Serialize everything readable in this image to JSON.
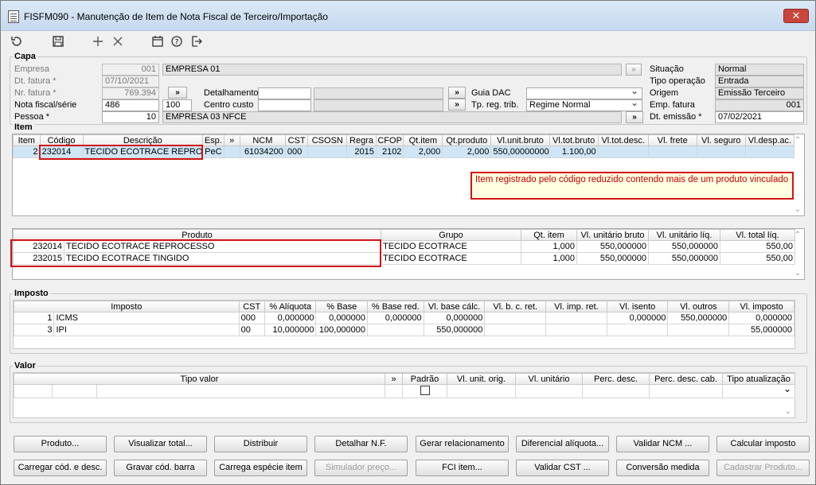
{
  "window": {
    "title": "FISFM090 - Manutenção de Item de Nota Fiscal de Terceiro/Importação",
    "close": "✕"
  },
  "toolbar": {
    "refresh": "↻",
    "save": "💾",
    "add": "+",
    "cancel": "✕",
    "calendar": "📅",
    "help": "?",
    "exit": "↦"
  },
  "capa": {
    "label": "Capa",
    "empresa_label": "Empresa",
    "empresa_code": "001",
    "empresa_name": "EMPRESA 01",
    "dt_fatura_label": "Dt. fatura *",
    "dt_fatura": "07/10/2021",
    "nr_fatura_label": "Nr. fatura *",
    "nr_fatura": "769.394",
    "nota_label": "Nota fiscal/série",
    "nota": "486",
    "serie": "100",
    "pessoa_label": "Pessoa *",
    "pessoa_code": "10",
    "pessoa_name": "EMPRESA 03 NFCE",
    "detalhamento_label": "Detalhamento",
    "centro_custo_label": "Centro custo",
    "guia_dac_label": "Guia DAC",
    "tp_reg_trib_label": "Tp. reg. trib.",
    "tp_reg_trib": "Regime Normal",
    "situacao_label": "Situação",
    "situacao": "Normal",
    "tipo_op_label": "Tipo operação",
    "tipo_op": "Entrada",
    "origem_label": "Origem",
    "origem": "Emissão Terceiro",
    "emp_fatura_label": "Emp. fatura",
    "emp_fatura": "001",
    "dt_emissao_label": "Dt. emissão *",
    "dt_emissao": "07/02/2021",
    "btn_more": "»",
    "btn_dots": "..."
  },
  "item": {
    "label": "Item",
    "columns": [
      "Item",
      "Código",
      "Descrição",
      "Esp.",
      "»",
      "NCM",
      "CST",
      "CSOSN",
      "Regra",
      "CFOP",
      "Qt.item",
      "Qt.produto",
      "Vl.unit.bruto",
      "Vl.tot.bruto",
      "Vl.tot.desc.",
      "Vl. frete",
      "Vl. seguro",
      "Vl.desp.ac."
    ],
    "rows": [
      {
        "item": "2",
        "codigo": "232014",
        "descricao": "TECIDO ECOTRACE REPROCE",
        "esp": "PeC",
        "more": "",
        "ncm": "61034200",
        "cst": "000",
        "csosn": "",
        "regra": "2015",
        "cfop": "2102",
        "qt_item": "2,000",
        "qt_produto": "2,000",
        "vl_unit_bruto": "550,00000000",
        "vl_tot_bruto": "1.100,00",
        "vl_tot_desc": "",
        "vl_frete": "",
        "vl_seguro": "",
        "vl_desp": ""
      }
    ],
    "note": "Item registrado pelo código reduzido contendo mais de um produto vinculado"
  },
  "produto": {
    "columns": [
      "Produto",
      "Grupo",
      "Qt. item",
      "Vl. unitário bruto",
      "Vl. unitário líq.",
      "Vl. total líq."
    ],
    "rows": [
      {
        "codigo": "232014",
        "nome": "TECIDO ECOTRACE REPROCESSO",
        "grupo": "TECIDO ECOTRACE",
        "qt": "1,000",
        "bruto": "550,000000",
        "liq": "550,000000",
        "total": "550,00"
      },
      {
        "codigo": "232015",
        "nome": "TECIDO ECOTRACE TINGIDO",
        "grupo": "TECIDO ECOTRACE",
        "qt": "1,000",
        "bruto": "550,000000",
        "liq": "550,000000",
        "total": "550,00"
      }
    ]
  },
  "imposto": {
    "label": "Imposto",
    "columns": [
      "Imposto",
      "CST",
      "% Alíquota",
      "% Base",
      "% Base red.",
      "Vl. base cálc.",
      "Vl. b. c. ret.",
      "Vl. imp. ret.",
      "Vl. isento",
      "Vl. outros",
      "Vl. imposto"
    ],
    "rows": [
      {
        "n": "1",
        "nome": "ICMS",
        "cst": "000",
        "aliq": "0,000000",
        "base": "0,000000",
        "base_red": "0,000000",
        "vl_base": "0,000000",
        "bc_ret": "",
        "imp_ret": "",
        "isento": "0,000000",
        "outros": "550,000000",
        "imposto": "0,000000"
      },
      {
        "n": "3",
        "nome": "IPI",
        "cst": "00",
        "aliq": "10,000000",
        "base": "100,000000",
        "base_red": "",
        "vl_base": "550,000000",
        "bc_ret": "",
        "imp_ret": "",
        "isento": "",
        "outros": "",
        "imposto": "55,000000"
      }
    ]
  },
  "valor": {
    "label": "Valor",
    "columns": [
      "Tipo valor",
      "»",
      "Padrão",
      "Vl. unit. orig.",
      "Vl. unitário",
      "Perc. desc.",
      "Perc. desc. cab.",
      "Tipo atualização"
    ]
  },
  "buttons": {
    "row1": [
      "Produto...",
      "Visualizar total...",
      "Distribuir",
      "Detalhar N.F.",
      "Gerar relacionamento",
      "Diferencial alíquota...",
      "Validar NCM ...",
      "Calcular imposto"
    ],
    "row2": [
      "Carregar cód. e desc.",
      "Gravar cód. barra",
      "Carrega espécie item",
      "Simulador preço...",
      "FCI item...",
      "Validar CST ...",
      "Conversão medida",
      "Cadastrar Produto..."
    ]
  }
}
